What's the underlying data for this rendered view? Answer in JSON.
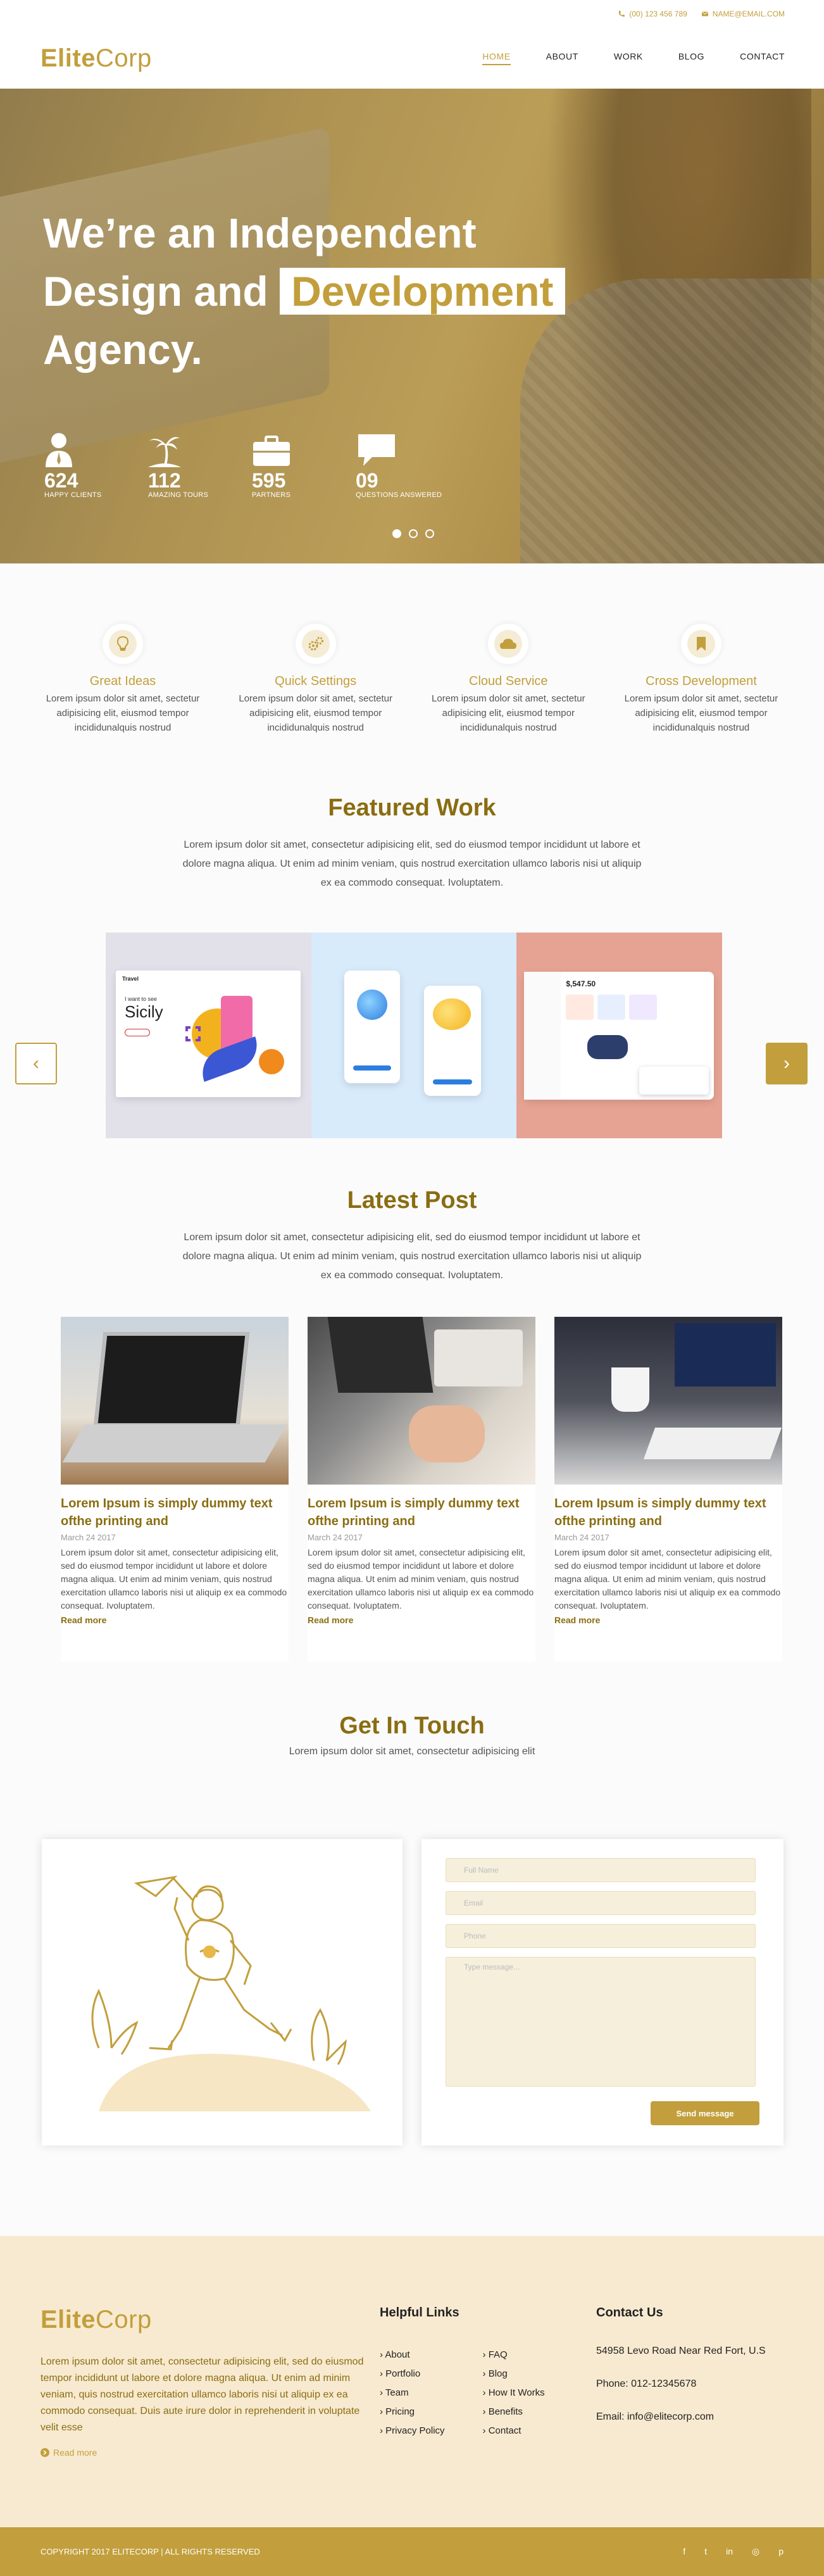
{
  "topbar": {
    "phone": "(00) 123 456 789",
    "email": "NAME@EMAIL.COM"
  },
  "logo": {
    "bold": "Elite",
    "thin": "Corp"
  },
  "nav": [
    {
      "label": "HOME",
      "active": true
    },
    {
      "label": "ABOUT"
    },
    {
      "label": "WORK"
    },
    {
      "label": "BLOG"
    },
    {
      "label": "CONTACT"
    }
  ],
  "hero": {
    "line1": "We’re an Independent",
    "line2a": "Design and",
    "line2b": "Development",
    "line3": "Agency.",
    "stats": [
      {
        "num": "624",
        "label": "HAPPY CLIENTS",
        "icon": "user-icon"
      },
      {
        "num": "112",
        "label": "AMAZING TOURS",
        "icon": "palm-tree-icon"
      },
      {
        "num": "595",
        "label": "PARTNERS",
        "icon": "briefcase-icon"
      },
      {
        "num": "09",
        "label": "QUESTIONS ANSWERED",
        "icon": "chat-bubble-icon"
      }
    ]
  },
  "features": [
    {
      "title": "Great Ideas",
      "text": "Lorem ipsum dolor sit amet, sectetur adipisicing elit, eiusmod tempor incididunalquis nostrud",
      "icon": "lightbulb-icon"
    },
    {
      "title": "Quick Settings",
      "text": "Lorem ipsum dolor sit amet, sectetur adipisicing elit, eiusmod tempor incididunalquis nostrud",
      "icon": "gears-icon"
    },
    {
      "title": "Cloud Service",
      "text": "Lorem ipsum dolor sit amet, sectetur adipisicing elit, eiusmod tempor incididunalquis nostrud",
      "icon": "cloud-icon"
    },
    {
      "title": "Cross Development",
      "text": "Lorem ipsum dolor sit amet, sectetur adipisicing elit, eiusmod tempor incididunalquis nostrud",
      "icon": "bookmark-icon"
    }
  ],
  "featured": {
    "title": "Featured Work",
    "text": "Lorem ipsum dolor sit amet, consectetur adipisicing elit, sed do eiusmod tempor incididunt ut labore et dolore magna aliqua. Ut enim ad minim veniam, quis nostrud exercitation ullamco laboris nisi ut aliquip ex ea commodo consequat. Ivoluptatem.",
    "slide1": {
      "brand": "Travel",
      "heading1": "I want to see",
      "heading2": "Sicily"
    },
    "slide3": {
      "amount": "$,547.50"
    }
  },
  "latest": {
    "title": "Latest Post",
    "text": "Lorem ipsum dolor sit amet, consectetur adipisicing elit, sed do eiusmod tempor incididunt ut labore et dolore magna aliqua. Ut enim ad minim veniam, quis nostrud exercitation ullamco laboris nisi ut aliquip ex ea commodo consequat. Ivoluptatem.",
    "posts": [
      {
        "title": "Lorem Ipsum is simply dummy text ofthe printing and",
        "date": "March 24 2017",
        "text": "Lorem ipsum dolor sit amet, consectetur adipisicing elit, sed do eiusmod tempor incididunt ut labore et dolore magna aliqua. Ut enim ad minim veniam, quis nostrud exercitation ullamco laboris nisi ut aliquip ex ea commodo consequat. Ivoluptatem.",
        "more": "Read more"
      },
      {
        "title": "Lorem Ipsum is simply dummy text ofthe printing and",
        "date": "March 24 2017",
        "text": "Lorem ipsum dolor sit amet, consectetur adipisicing elit, sed do eiusmod tempor incididunt ut labore et dolore magna aliqua. Ut enim ad minim veniam, quis nostrud exercitation ullamco laboris nisi ut aliquip ex ea commodo consequat. Ivoluptatem.",
        "more": "Read more"
      },
      {
        "title": "Lorem Ipsum is simply dummy text ofthe printing and",
        "date": "March 24 2017",
        "text": "Lorem ipsum dolor sit amet, consectetur adipisicing elit, sed do eiusmod tempor incididunt ut labore et dolore magna aliqua. Ut enim ad minim veniam, quis nostrud exercitation ullamco laboris nisi ut aliquip ex ea commodo consequat. Ivoluptatem.",
        "more": "Read more"
      }
    ]
  },
  "contact": {
    "title": "Get In Touch",
    "subtitle": "Lorem ipsum dolor sit amet, consectetur adipisicing elit",
    "placeholders": {
      "name": "Full Name",
      "email": "Email",
      "phone": "Phone",
      "message": "Type message..."
    },
    "send": "Send message"
  },
  "footer": {
    "about": "Lorem ipsum dolor sit amet, consectetur adipisicing elit, sed do eiusmod tempor incididunt ut labore et dolore magna aliqua. Ut enim ad minim veniam, quis nostrud exercitation ullamco laboris nisi ut aliquip ex ea commodo consequat. Duis aute irure dolor in reprehenderit in voluptate velit esse",
    "readmore": "Read more",
    "links_title": "Helpful Links",
    "links_col1": [
      "About",
      "Portfolio",
      "Team",
      "Pricing",
      "Privacy Policy"
    ],
    "links_col2": [
      "FAQ",
      "Blog",
      "How It Works",
      "Benefits",
      "Contact"
    ],
    "contact_title": "Contact Us",
    "address": "54958 Levo Road Near Red Fort, U.S",
    "phone": "Phone: 012-12345678",
    "email": "Email: info@elitecorp.com",
    "copyright": "COPYRIGHT 2017 ELITECORP | ALL RIGHTS RESERVED",
    "social": [
      {
        "icon": "facebook-icon",
        "glyph": "f"
      },
      {
        "icon": "twitter-icon",
        "glyph": "t"
      },
      {
        "icon": "linkedin-icon",
        "glyph": "in"
      },
      {
        "icon": "instagram-icon",
        "glyph": "◎"
      },
      {
        "icon": "pinterest-icon",
        "glyph": "p"
      }
    ]
  },
  "colors": {
    "accent": "#c29f3c",
    "accent_dark": "#8a6d12",
    "footer_bg": "#f8ead0"
  }
}
